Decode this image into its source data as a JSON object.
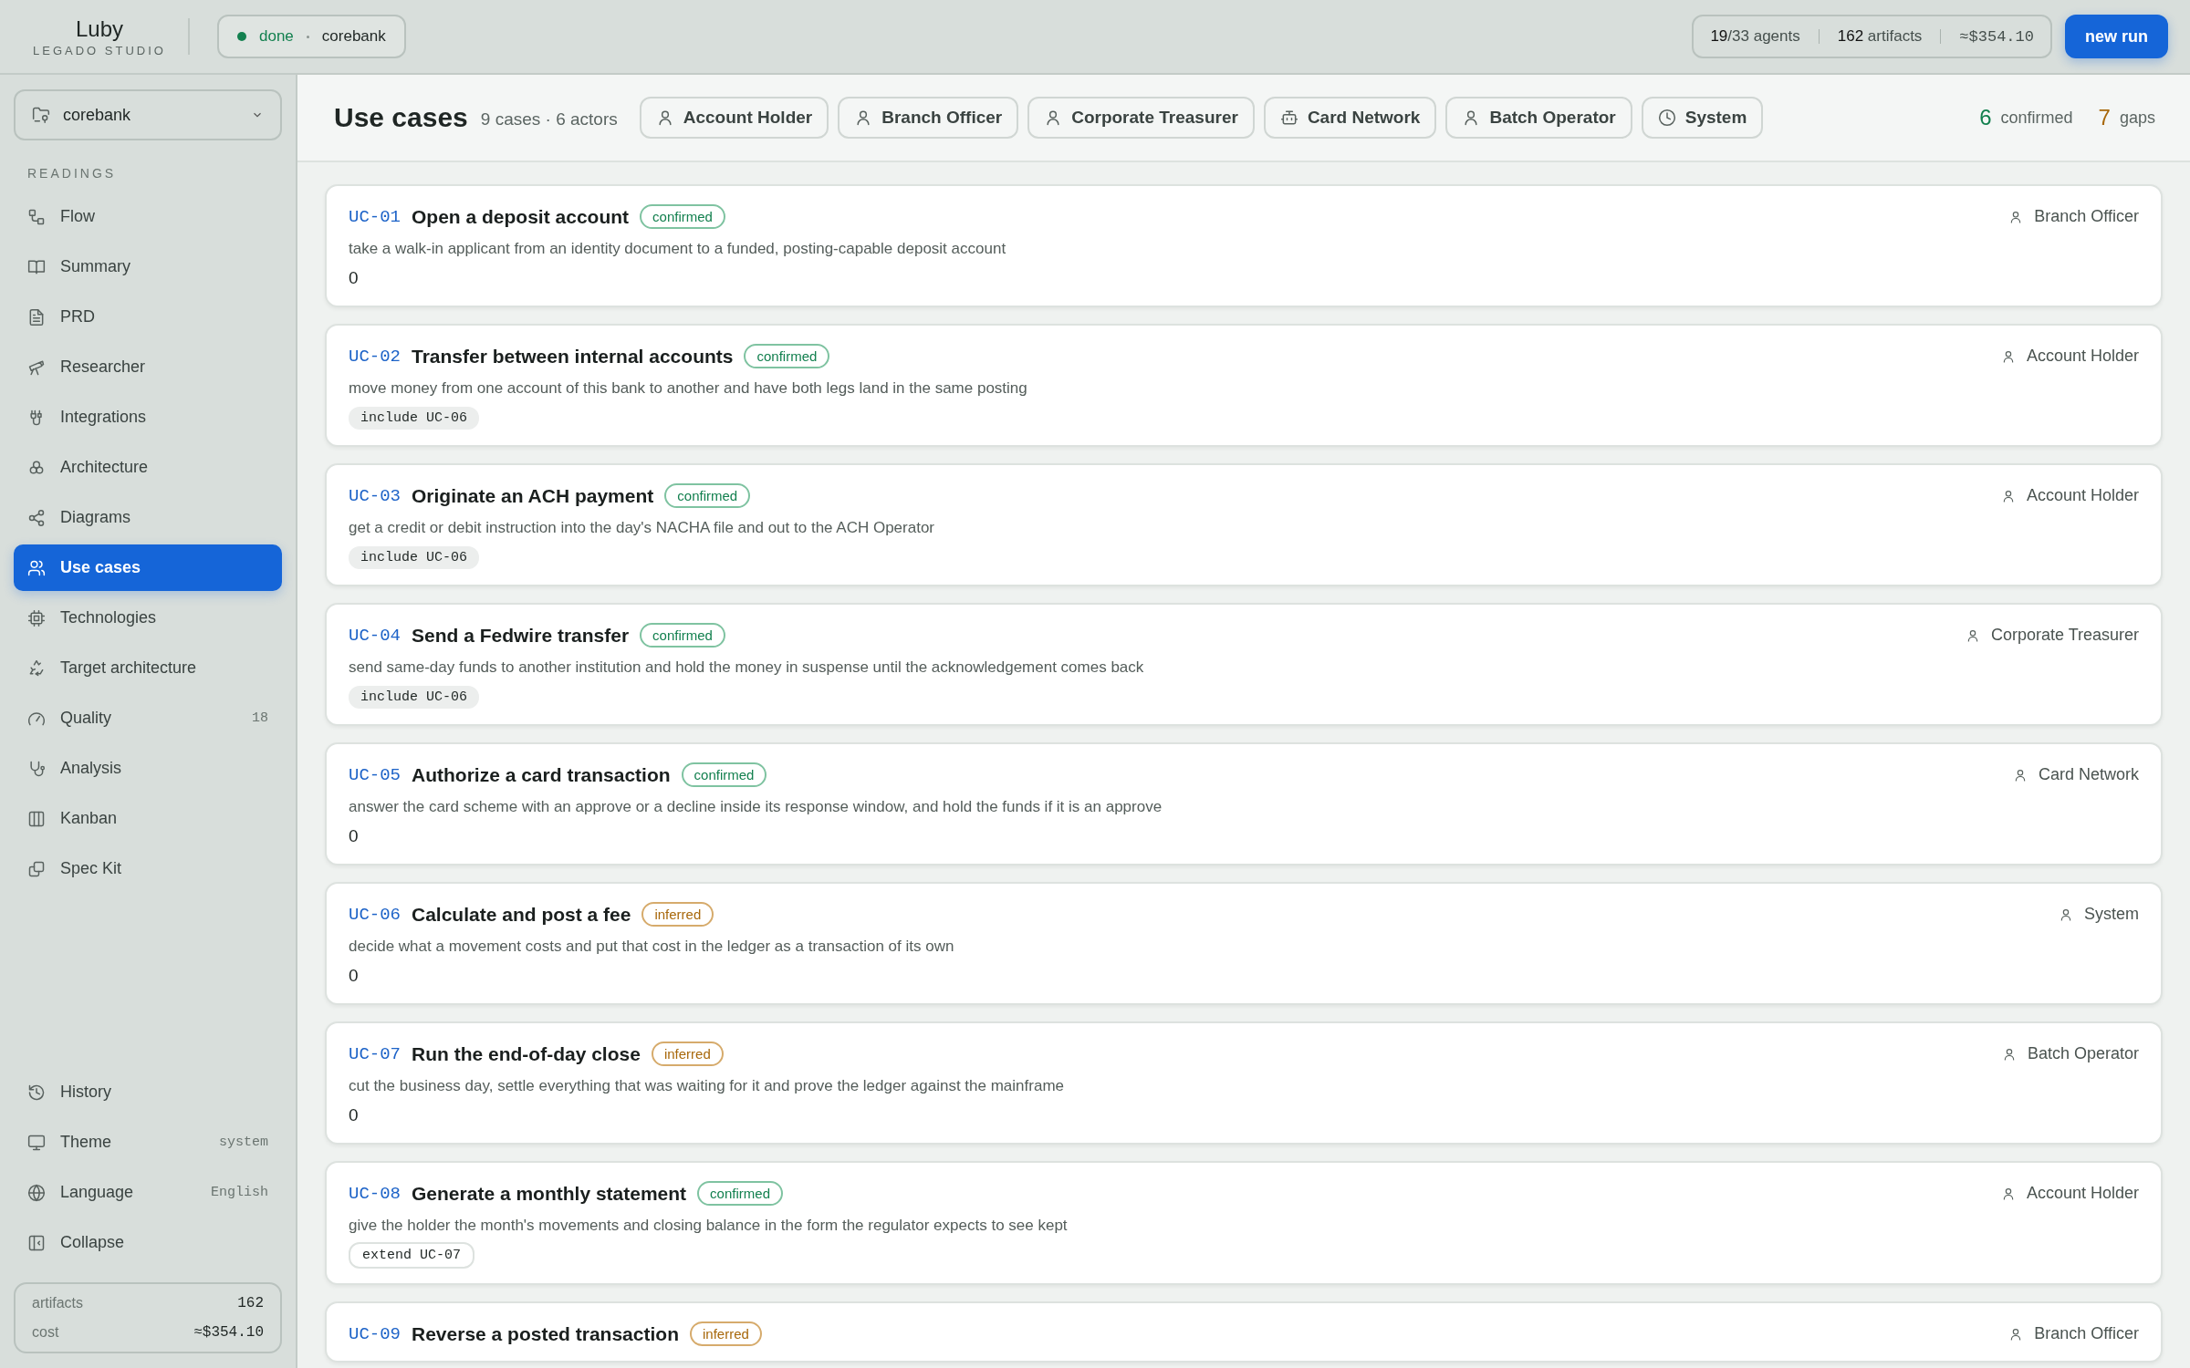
{
  "brand": {
    "name": "Luby",
    "subtitle": "LEGADO STUDIO"
  },
  "run_status": {
    "state": "done",
    "project": "corebank"
  },
  "stats": {
    "agents_done": "19",
    "agents_total": "/33 agents",
    "artifacts_count": "162",
    "artifacts_label": "artifacts",
    "cost": "≈$354.10"
  },
  "new_run_button": "new run",
  "project_select": {
    "value": "corebank"
  },
  "sidebar": {
    "section": "READINGS",
    "items": [
      {
        "label": "Flow",
        "selected": false
      },
      {
        "label": "Summary",
        "selected": false
      },
      {
        "label": "PRD",
        "selected": false
      },
      {
        "label": "Researcher",
        "selected": false
      },
      {
        "label": "Integrations",
        "selected": false
      },
      {
        "label": "Architecture",
        "selected": false
      },
      {
        "label": "Diagrams",
        "selected": false
      },
      {
        "label": "Use cases",
        "selected": true
      },
      {
        "label": "Technologies",
        "selected": false
      },
      {
        "label": "Target architecture",
        "selected": false
      },
      {
        "label": "Quality",
        "selected": false,
        "badge": "18"
      },
      {
        "label": "Analysis",
        "selected": false
      },
      {
        "label": "Kanban",
        "selected": false
      },
      {
        "label": "Spec Kit",
        "selected": false
      }
    ],
    "footer_items": [
      {
        "label": "History"
      },
      {
        "label": "Theme",
        "value": "system"
      },
      {
        "label": "Language",
        "value": "English"
      },
      {
        "label": "Collapse"
      }
    ],
    "totals": [
      {
        "label": "artifacts",
        "value": "162"
      },
      {
        "label": "cost",
        "value": "≈$354.10"
      }
    ]
  },
  "header": {
    "title": "Use cases",
    "subtitle": "9 cases · 6 actors",
    "actors": [
      {
        "label": "Account Holder",
        "kind": "human"
      },
      {
        "label": "Branch Officer",
        "kind": "human"
      },
      {
        "label": "Corporate Treasurer",
        "kind": "human"
      },
      {
        "label": "Card Network",
        "kind": "device"
      },
      {
        "label": "Batch Operator",
        "kind": "human"
      },
      {
        "label": "System",
        "kind": "system"
      }
    ],
    "confirmed_count": "6",
    "confirmed_label": "confirmed",
    "gaps_count": "7",
    "gaps_label": "gaps"
  },
  "use_cases": [
    {
      "id": "UC-01",
      "title": "Open a deposit account",
      "status": "confirmed",
      "confirmed": true,
      "actor": "Branch Officer",
      "description": "take a walk-in applicant from an identity document to a funded, posting-capable deposit account",
      "relation_count": "0"
    },
    {
      "id": "UC-02",
      "title": "Transfer between internal accounts",
      "status": "confirmed",
      "confirmed": true,
      "actor": "Account Holder",
      "description": "move money from one account of this bank to another and have both legs land in the same posting",
      "relations": [
        {
          "label": "include UC-06",
          "kind": "include"
        }
      ]
    },
    {
      "id": "UC-03",
      "title": "Originate an ACH payment",
      "status": "confirmed",
      "confirmed": true,
      "actor": "Account Holder",
      "description": "get a credit or debit instruction into the day's NACHA file and out to the ACH Operator",
      "relations": [
        {
          "label": "include UC-06",
          "kind": "include"
        }
      ]
    },
    {
      "id": "UC-04",
      "title": "Send a Fedwire transfer",
      "status": "confirmed",
      "confirmed": true,
      "actor": "Corporate Treasurer",
      "description": "send same-day funds to another institution and hold the money in suspense until the acknowledgement comes back",
      "relations": [
        {
          "label": "include UC-06",
          "kind": "include"
        }
      ]
    },
    {
      "id": "UC-05",
      "title": "Authorize a card transaction",
      "status": "confirmed",
      "confirmed": true,
      "actor": "Card Network",
      "description": "answer the card scheme with an approve or a decline inside its response window, and hold the funds if it is an approve",
      "relation_count": "0"
    },
    {
      "id": "UC-06",
      "title": "Calculate and post a fee",
      "status": "inferred",
      "confirmed": false,
      "actor": "System",
      "description": "decide what a movement costs and put that cost in the ledger as a transaction of its own",
      "relation_count": "0"
    },
    {
      "id": "UC-07",
      "title": "Run the end-of-day close",
      "status": "inferred",
      "confirmed": false,
      "actor": "Batch Operator",
      "description": "cut the business day, settle everything that was waiting for it and prove the ledger against the mainframe",
      "relation_count": "0"
    },
    {
      "id": "UC-08",
      "title": "Generate a monthly statement",
      "status": "confirmed",
      "confirmed": true,
      "actor": "Account Holder",
      "description": "give the holder the month's movements and closing balance in the form the regulator expects to see kept",
      "relations": [
        {
          "label": "extend UC-07",
          "kind": "extend"
        }
      ]
    },
    {
      "id": "UC-09",
      "title": "Reverse a posted transaction",
      "status": "inferred",
      "confirmed": false,
      "actor": "Branch Officer"
    }
  ]
}
